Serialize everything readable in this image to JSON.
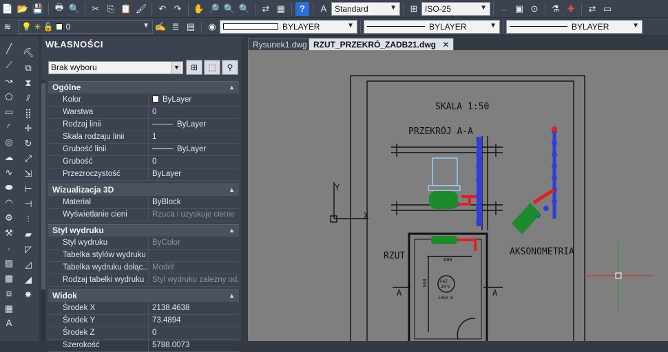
{
  "toolbar1": {
    "text_style": "Standard",
    "dim_style": "ISO-25"
  },
  "toolbar2": {
    "layer": "0",
    "color": "BYLAYER",
    "linetype": "BYLAYER",
    "lineweight": "BYLAYER"
  },
  "properties": {
    "title": "WŁASNOŚCI",
    "selection": "Brak wyboru",
    "sections": [
      {
        "title": "Ogólne",
        "rows": [
          {
            "key": "Kolor",
            "value": "ByLayer"
          },
          {
            "key": "Warstwa",
            "value": "0"
          },
          {
            "key": "Rodzaj linii",
            "value": "ByLayer"
          },
          {
            "key": "Skala rodzaju linii",
            "value": "1"
          },
          {
            "key": "Grubość linii",
            "value": "ByLayer"
          },
          {
            "key": "Grubość",
            "value": "0"
          },
          {
            "key": "Przezroczystość",
            "value": "ByLayer"
          }
        ]
      },
      {
        "title": "Wizualizacja 3D",
        "rows": [
          {
            "key": "Materiał",
            "value": "ByBlock"
          },
          {
            "key": "Wyświetlanie cieni",
            "value": "Rzuca i uzyskuje cienie"
          }
        ]
      },
      {
        "title": "Styl wydruku",
        "rows": [
          {
            "key": "Styl wydruku",
            "value": "ByColor"
          },
          {
            "key": "Tabelka stylów wydruku",
            "value": ""
          },
          {
            "key": "Tabelka wydruku dołąc...",
            "value": "Model"
          },
          {
            "key": "Rodzaj tabelki wydruku",
            "value": "Styl wydruku zależny od..."
          }
        ]
      },
      {
        "title": "Widok",
        "rows": [
          {
            "key": "Środek X",
            "value": "2138.4638"
          },
          {
            "key": "Środek Y",
            "value": "73.4894"
          },
          {
            "key": "Środek Z",
            "value": "0"
          },
          {
            "key": "Szerokość",
            "value": "5788.0073"
          }
        ]
      }
    ]
  },
  "tabs": [
    {
      "label": "Rysunek1.dwg",
      "active": false
    },
    {
      "label": "RZUT_PRZEKRÓ_ZADB21.dwg",
      "active": true
    }
  ],
  "drawing": {
    "scale_label": "SKALA 1:50",
    "section_label": "PRZEKRÓJ A-A",
    "plan_label": "RZUT",
    "axo_label": "AKSONOMETRIA",
    "axis_y": "Y",
    "axis_x": "X",
    "dim_600": "600",
    "dim_940": "940",
    "section_mark_left": "A",
    "section_mark_right": "A",
    "room_label": "ŁAZ",
    "room_temp": "20°C",
    "room_load": "1050 W",
    "colors": {
      "pipe_blue": "#2f3fd8",
      "pipe_red": "#e02020",
      "heater_green": "#1e8a2e",
      "crosshair_red": "#e02020",
      "crosshair_green": "#1f9a2a"
    }
  }
}
